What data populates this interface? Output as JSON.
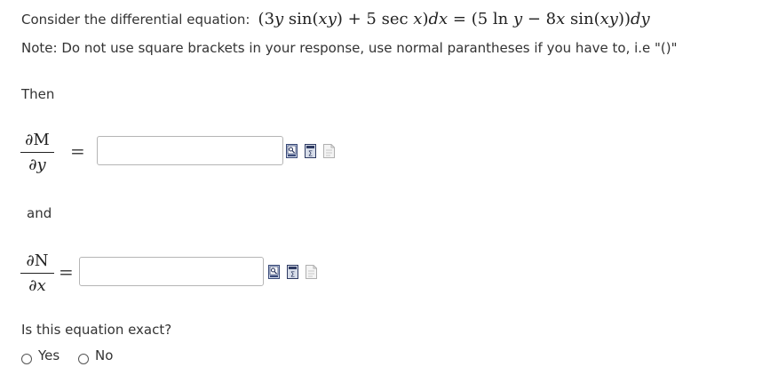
{
  "prompt": {
    "intro": "Consider the differential equation:",
    "note": "Note: Do not use square brackets in your response, use normal parantheses if you have to, i.e \"()\""
  },
  "equation": {
    "lhs_open": "(3",
    "y1": "y",
    "sin1": " sin(",
    "xy1": "xy",
    "plus": ") + 5 sec ",
    "x1": "x",
    "close1": ")",
    "dx": "dx",
    "equals": " = ",
    "rhs_open": "(5 ln ",
    "y2": "y",
    "minus": " − 8",
    "x2": "x",
    "sin2": " sin(",
    "xy2": "xy",
    "close2": "))",
    "dy": "dy"
  },
  "then_label": "Then",
  "and_label": "and",
  "dM_dy": {
    "numerator": "∂M",
    "denominator": "∂y",
    "equals": "=",
    "value": ""
  },
  "dN_dx": {
    "numerator": "∂N",
    "denominator": "∂x",
    "equals": "=",
    "value": ""
  },
  "question": "Is this equation exact?",
  "options": [
    "Yes",
    "No"
  ],
  "tool_icons": [
    "preview-icon",
    "equation-editor-icon",
    "help-icon"
  ]
}
